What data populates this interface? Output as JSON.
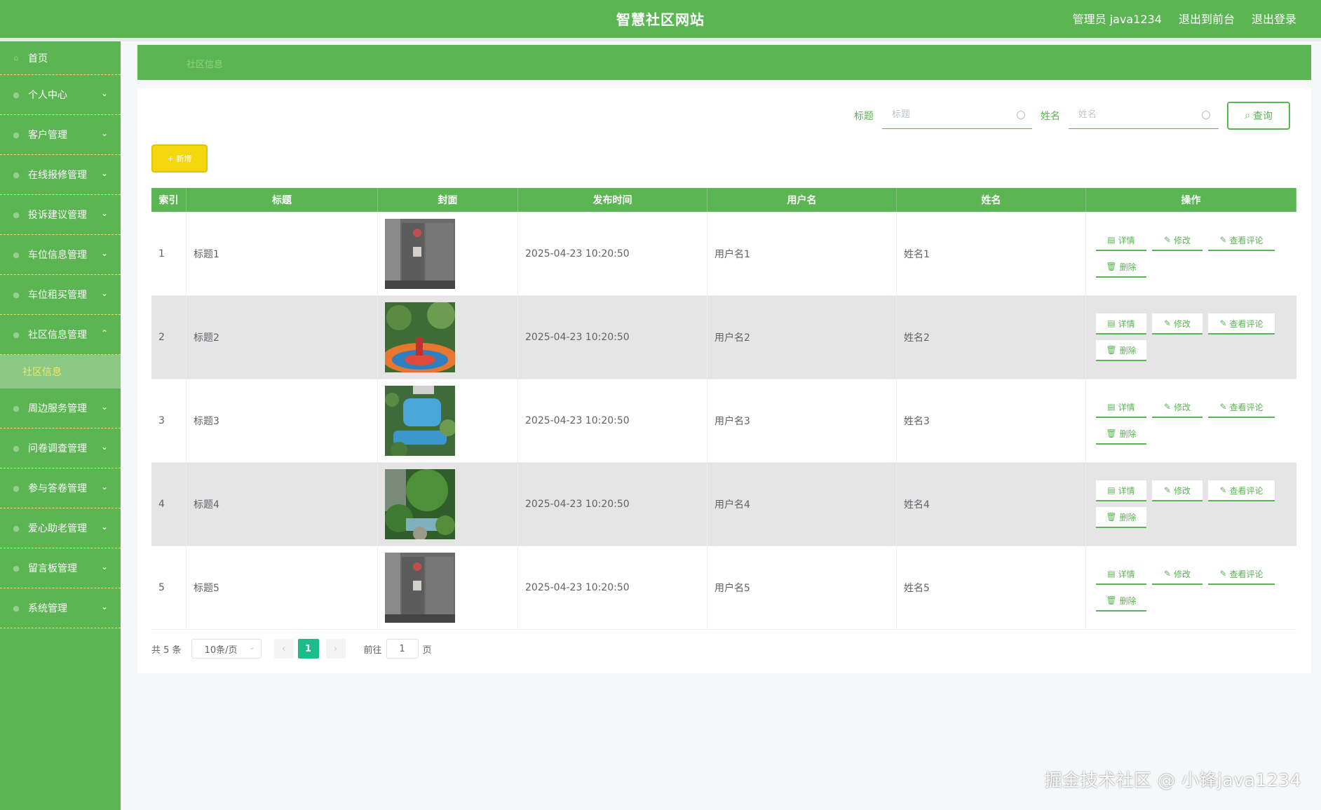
{
  "header": {
    "title": "智慧社区网站",
    "admin_label": "管理员 java1234",
    "back_to_front": "退出到前台",
    "logout": "退出登录"
  },
  "sidebar": {
    "items": [
      {
        "label": "首页",
        "icon": "home-icon",
        "expandable": false
      },
      {
        "label": "个人中心",
        "icon": "user-icon",
        "expandable": true
      },
      {
        "label": "客户管理",
        "icon": "customer-icon",
        "expandable": true
      },
      {
        "label": "在线报修管理",
        "icon": "repair-icon",
        "expandable": true
      },
      {
        "label": "投诉建议管理",
        "icon": "complaint-icon",
        "expandable": true
      },
      {
        "label": "车位信息管理",
        "icon": "parking-icon",
        "expandable": true
      },
      {
        "label": "车位租买管理",
        "icon": "parking-rent-icon",
        "expandable": true
      },
      {
        "label": "社区信息管理",
        "icon": "community-icon",
        "expandable": true,
        "expanded": true
      },
      {
        "label": "周边服务管理",
        "icon": "service-icon",
        "expandable": true
      },
      {
        "label": "问卷调查管理",
        "icon": "survey-icon",
        "expandable": true
      },
      {
        "label": "参与答卷管理",
        "icon": "answer-icon",
        "expandable": true
      },
      {
        "label": "爱心助老管理",
        "icon": "elderly-icon",
        "expandable": true
      },
      {
        "label": "留言板管理",
        "icon": "message-icon",
        "expandable": true
      },
      {
        "label": "系统管理",
        "icon": "settings-icon",
        "expandable": true
      }
    ],
    "active_sub": "社区信息"
  },
  "breadcrumb": "社区信息",
  "search": {
    "title_label": "标题",
    "title_placeholder": "标题",
    "name_label": "姓名",
    "name_placeholder": "姓名",
    "query_label": "查询"
  },
  "add_label": "+ 新增",
  "table": {
    "headers": [
      "索引",
      "标题",
      "封面",
      "发布时间",
      "用户名",
      "姓名",
      "操作"
    ],
    "rows": [
      {
        "idx": "1",
        "title": "标题1",
        "cover": "elevator",
        "time": "2025-04-23 10:20:50",
        "user": "用户名1",
        "name": "姓名1"
      },
      {
        "idx": "2",
        "title": "标题2",
        "cover": "playground",
        "time": "2025-04-23 10:20:50",
        "user": "用户名2",
        "name": "姓名2"
      },
      {
        "idx": "3",
        "title": "标题3",
        "cover": "pool",
        "time": "2025-04-23 10:20:50",
        "user": "用户名3",
        "name": "姓名3"
      },
      {
        "idx": "4",
        "title": "标题4",
        "cover": "garden",
        "time": "2025-04-23 10:20:50",
        "user": "用户名4",
        "name": "姓名4"
      },
      {
        "idx": "5",
        "title": "标题5",
        "cover": "elevator",
        "time": "2025-04-23 10:20:50",
        "user": "用户名5",
        "name": "姓名5"
      }
    ],
    "actions": {
      "detail": "详情",
      "edit": "修改",
      "comments": "查看评论",
      "delete": "删除"
    }
  },
  "pagination": {
    "total": "共 5 条",
    "page_size": "10条/页",
    "current": "1",
    "goto_prefix": "前往",
    "goto_value": "1",
    "goto_suffix": "页"
  },
  "watermark": "掘金技术社区 @ 小锋java1234",
  "colors": {
    "primary": "#5ab552",
    "accent_yellow": "#f4d80d",
    "page_active": "#1dbd8b",
    "row_alt": "#e5e5e5"
  }
}
